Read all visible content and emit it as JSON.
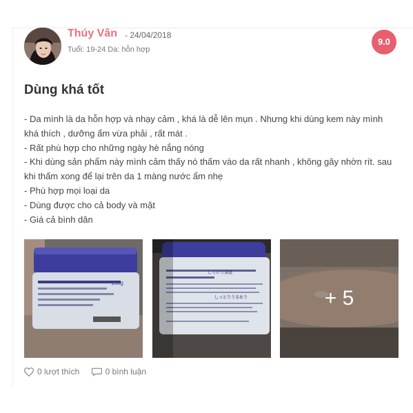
{
  "review": {
    "author": {
      "name": "Thúy Vân",
      "date": "- 24/04/2018",
      "meta": "Tuổi: 19-24 Da: hỗn hợp"
    },
    "score": "9.0",
    "title": "Dùng khá tốt",
    "body_lines": [
      "- Da mình là da hỗn hợp và nhạy cảm , khá là dễ lên mụn . Nhưng khi dùng kem này mình",
      "khá thích , dưỡng ẩm vừa phải , rất mát .",
      "- Rất phù hợp cho những ngày hè nắng nóng",
      "- Khi dùng sản phẩm này mình cảm thấy nó thấm vào da rất nhanh , không gây nhờn rít. sau",
      "khi thấm xong để lại trên da 1 màng nước ẩm nhẹ",
      "- Phù hợp mọi loại da",
      "- Dùng được cho cả body và mặt",
      "- Giá cả bình dân"
    ],
    "photos": {
      "photo1_label": "180g",
      "photo2_label_1": "しっかり浸透",
      "photo2_label_2": "しっとりうるおう",
      "more_label": "+ 5"
    },
    "actions": {
      "likes": "0 lượt thích",
      "comments": "0 bình luận"
    }
  },
  "colors": {
    "author_name": "#e5717e",
    "score_bg": "#e85f6d",
    "jar_lid": "#3c3d9c"
  },
  "icons": [
    "heart-icon",
    "comment-icon"
  ]
}
